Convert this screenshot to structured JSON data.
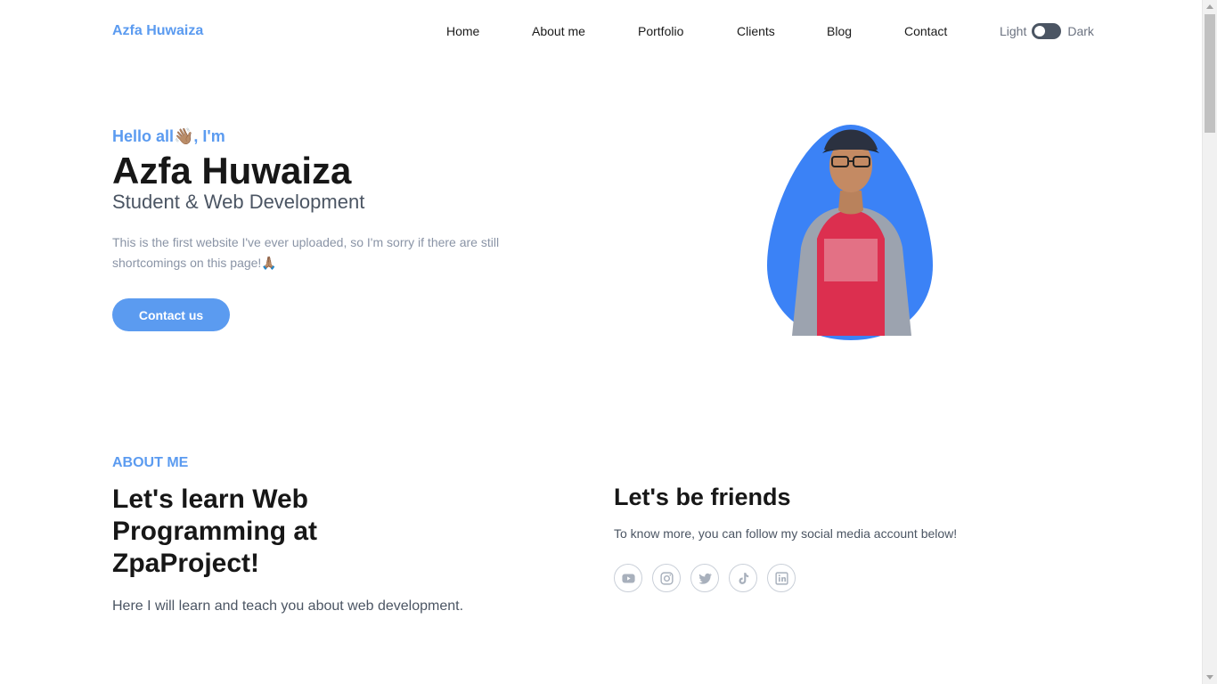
{
  "nav": {
    "brand": "Azfa Huwaiza",
    "links": [
      "Home",
      "About me",
      "Portfolio",
      "Clients",
      "Blog",
      "Contact"
    ],
    "theme": {
      "light_label": "Light",
      "dark_label": "Dark"
    }
  },
  "hero": {
    "greeting": "Hello all👋🏽, I'm",
    "name": "Azfa Huwaiza",
    "role": "Student & Web Development",
    "description": "This is the first website I've ever uploaded, so I'm sorry if there are still shortcomings on this page!🙏🏽",
    "button": "Contact us"
  },
  "about": {
    "label": "ABOUT ME",
    "title": "Let's learn Web Programming at ZpaProject!",
    "text": "Here I will learn and teach you about web development."
  },
  "friends": {
    "title": "Let's be friends",
    "text": "To know more, you can follow my social media account below!",
    "socials": [
      "youtube-icon",
      "instagram-icon",
      "twitter-icon",
      "tiktok-icon",
      "linkedin-icon"
    ]
  },
  "colors": {
    "accent": "#5b9bf0",
    "blob": "#3b82f6",
    "heading": "#171717",
    "muted": "#8a94a6"
  }
}
